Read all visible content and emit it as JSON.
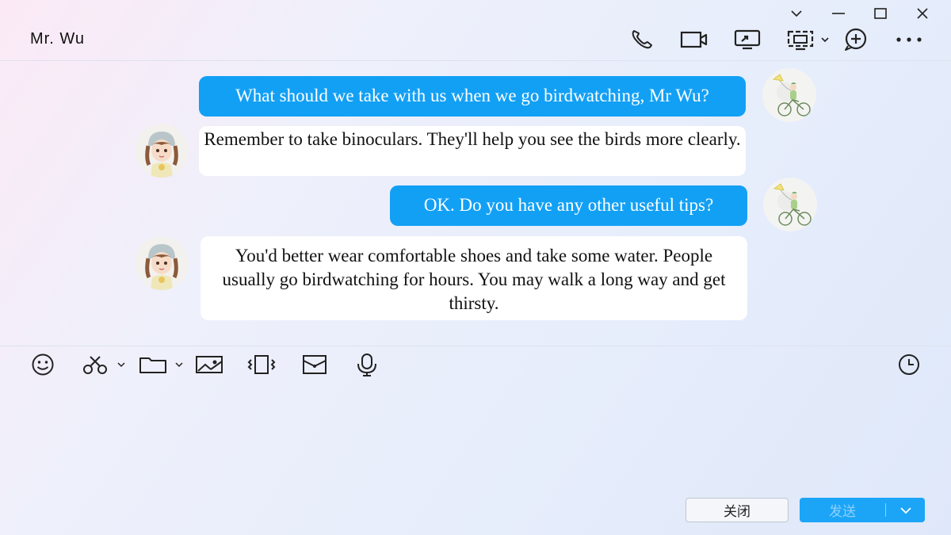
{
  "window": {
    "title": "Mr. Wu",
    "controls": [
      "chevron-down-icon",
      "minimize-icon",
      "maximize-icon",
      "close-icon"
    ]
  },
  "header": {
    "actions": [
      "phone-icon",
      "video-call-icon",
      "screen-share-icon",
      "remote-desktop-icon",
      "add-member-icon",
      "more-icon"
    ]
  },
  "messages": [
    {
      "direction": "out",
      "sender": "me",
      "text": "What should we take with us when we go birdwatching, Mr Wu?"
    },
    {
      "direction": "in",
      "sender": "Mr. Wu",
      "text": "Remember to take binoculars. They'll help you see the birds more clearly."
    },
    {
      "direction": "out",
      "sender": "me",
      "text": "OK. Do you have any other useful tips?"
    },
    {
      "direction": "in",
      "sender": "Mr. Wu",
      "text": "You'd better wear comfortable shoes and take some water. People usually go birdwatching for hours. You may walk a long way and get thirsty."
    }
  ],
  "input_toolbar": [
    "emoji-icon",
    "screenshot-scissors-icon",
    "folder-icon",
    "image-icon",
    "shake-icon",
    "red-packet-icon",
    "microphone-icon",
    "history-clock-icon"
  ],
  "buttons": {
    "close_label": "关闭",
    "send_label": "发送"
  },
  "colors": {
    "outgoing_bubble": "#12a0f5",
    "incoming_bubble": "#ffffff",
    "send_button": "#1ca5f7"
  }
}
